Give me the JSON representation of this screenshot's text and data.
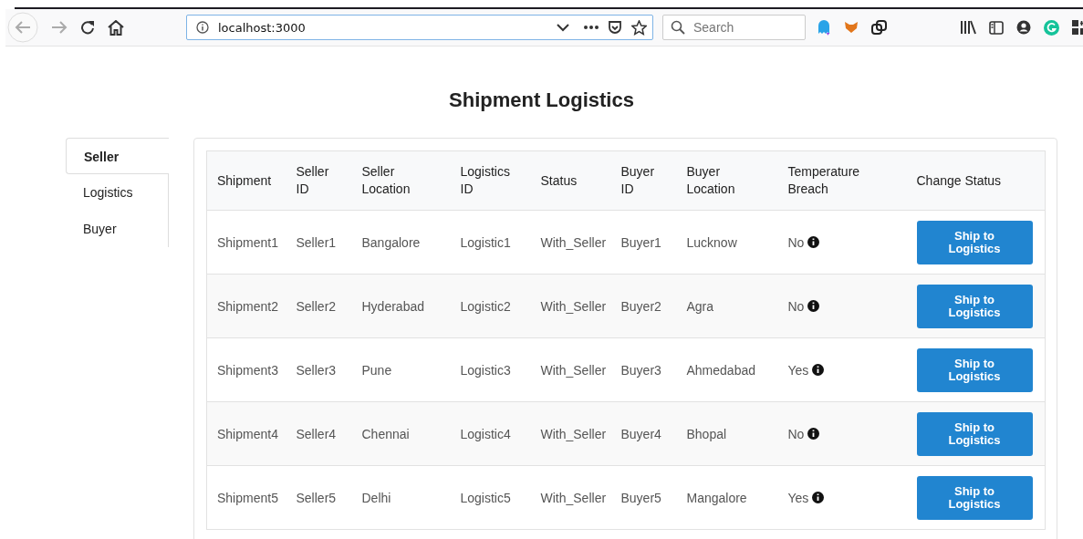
{
  "browser": {
    "url": "localhost:3000",
    "search": {
      "placeholder": "Search"
    }
  },
  "page": {
    "title": "Shipment Logistics"
  },
  "sidebar": {
    "items": [
      {
        "label": "Seller",
        "selected": true
      },
      {
        "label": "Logistics",
        "selected": false
      },
      {
        "label": "Buyer",
        "selected": false
      }
    ]
  },
  "table": {
    "columns": [
      "Shipment",
      "Seller ID",
      "Seller Location",
      "Logistics ID",
      "Status",
      "Buyer ID",
      "Buyer Location",
      "Temperature Breach",
      "Change Status"
    ],
    "rows": [
      {
        "cells": [
          "Shipment1",
          "Seller1",
          "Bangalore",
          "Logistic1",
          "With_Seller",
          "Buyer1",
          "Lucknow",
          "No"
        ],
        "action": "Ship to Logistics"
      },
      {
        "cells": [
          "Shipment2",
          "Seller2",
          "Hyderabad",
          "Logistic2",
          "With_Seller",
          "Buyer2",
          "Agra",
          "No"
        ],
        "action": "Ship to Logistics"
      },
      {
        "cells": [
          "Shipment3",
          "Seller3",
          "Pune",
          "Logistic3",
          "With_Seller",
          "Buyer3",
          "Ahmedabad",
          "Yes"
        ],
        "action": "Ship to Logistics"
      },
      {
        "cells": [
          "Shipment4",
          "Seller4",
          "Chennai",
          "Logistic4",
          "With_Seller",
          "Buyer4",
          "Bhopal",
          "No"
        ],
        "action": "Ship to Logistics"
      },
      {
        "cells": [
          "Shipment5",
          "Seller5",
          "Delhi",
          "Logistic5",
          "With_Seller",
          "Buyer5",
          "Mangalore",
          "Yes"
        ],
        "action": "Ship to Logistics"
      }
    ]
  }
}
